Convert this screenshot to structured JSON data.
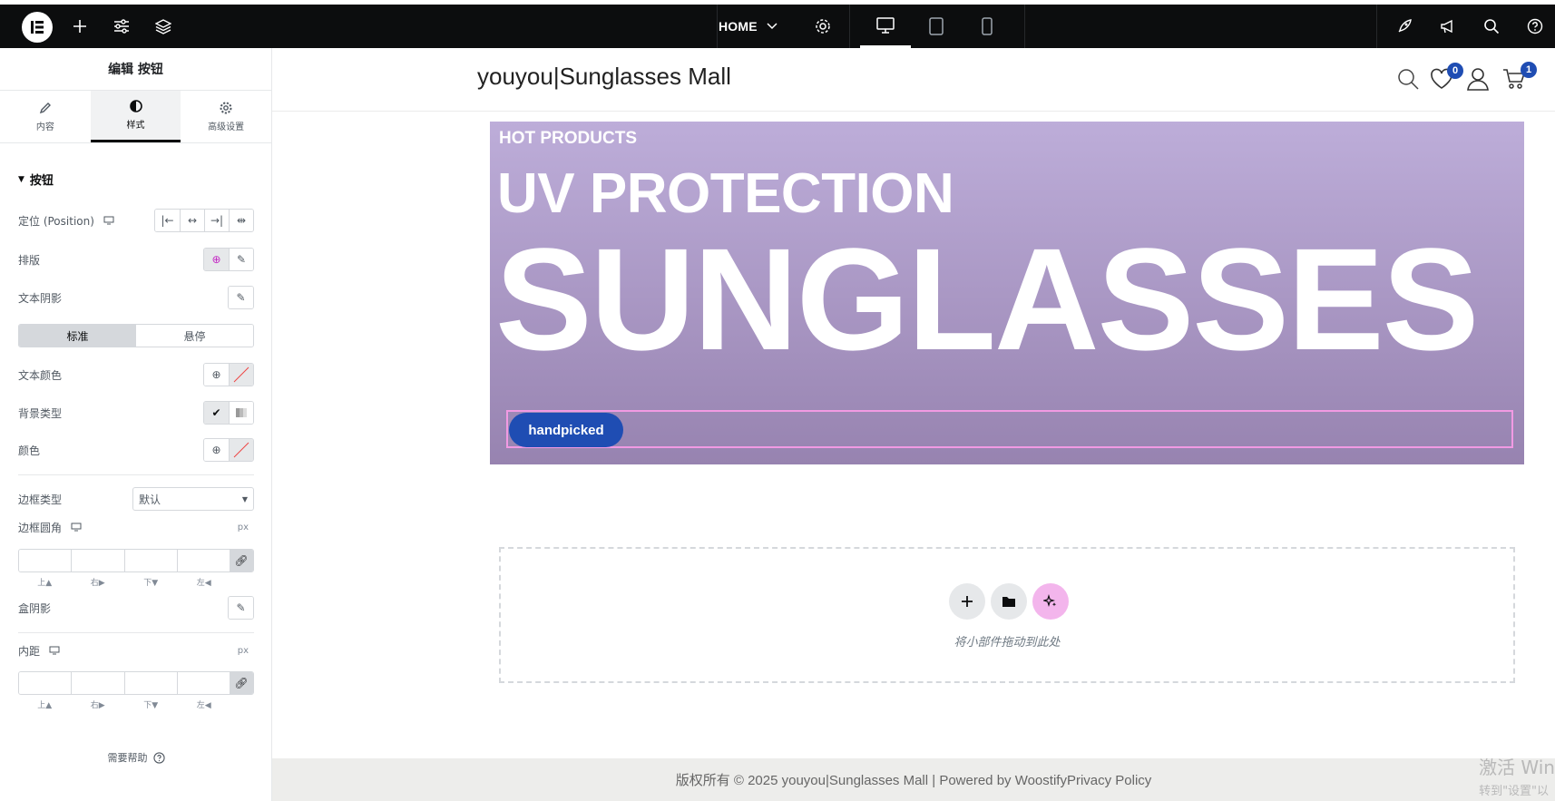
{
  "topbar": {
    "page_selector": "HOME"
  },
  "panel": {
    "title": "编辑 按钮",
    "tabs": [
      {
        "label": "内容",
        "icon": "pencil-icon"
      },
      {
        "label": "样式",
        "icon": "half-circle-icon"
      },
      {
        "label": "高级设置",
        "icon": "gear-icon"
      }
    ],
    "section_title": "按钮",
    "position_label": "定位 (Position)",
    "typography_label": "排版",
    "text_shadow_label": "文本阴影",
    "state_tabs": [
      "标准",
      "悬停"
    ],
    "text_color_label": "文本颜色",
    "bg_type_label": "背景类型",
    "color_label": "颜色",
    "border_type_label": "边框类型",
    "border_type_value": "默认",
    "border_radius_label": "边框圆角",
    "unit": "px",
    "dim_labels": [
      "上▲",
      "右▶",
      "下▼",
      "左◀"
    ],
    "box_shadow_label": "盒阴影",
    "padding_label": "内距",
    "help_label": "需要帮助"
  },
  "site": {
    "title": "youyou|Sunglasses Mall",
    "wishlist_count": "0",
    "cart_count": "1"
  },
  "hero": {
    "kicker": "HOT PRODUCTS",
    "headline": "UV PROTECTION",
    "big": "SUNGLASSES",
    "button": "handpicked"
  },
  "dropzone": {
    "text": "将小部件拖动到此处"
  },
  "footer": {
    "text": "版权所有 © 2025 youyou|Sunglasses Mall | Powered by WoostifyPrivacy Policy"
  },
  "watermark": {
    "line1": "激活 Win",
    "line2": "转到\"设置\"以"
  },
  "colors": {
    "topbar": "#0c0d0e",
    "hero_top": "#bdadd9",
    "hero_bottom": "#9783b0",
    "button": "#1f4db3",
    "selection": "#f19ae3"
  }
}
